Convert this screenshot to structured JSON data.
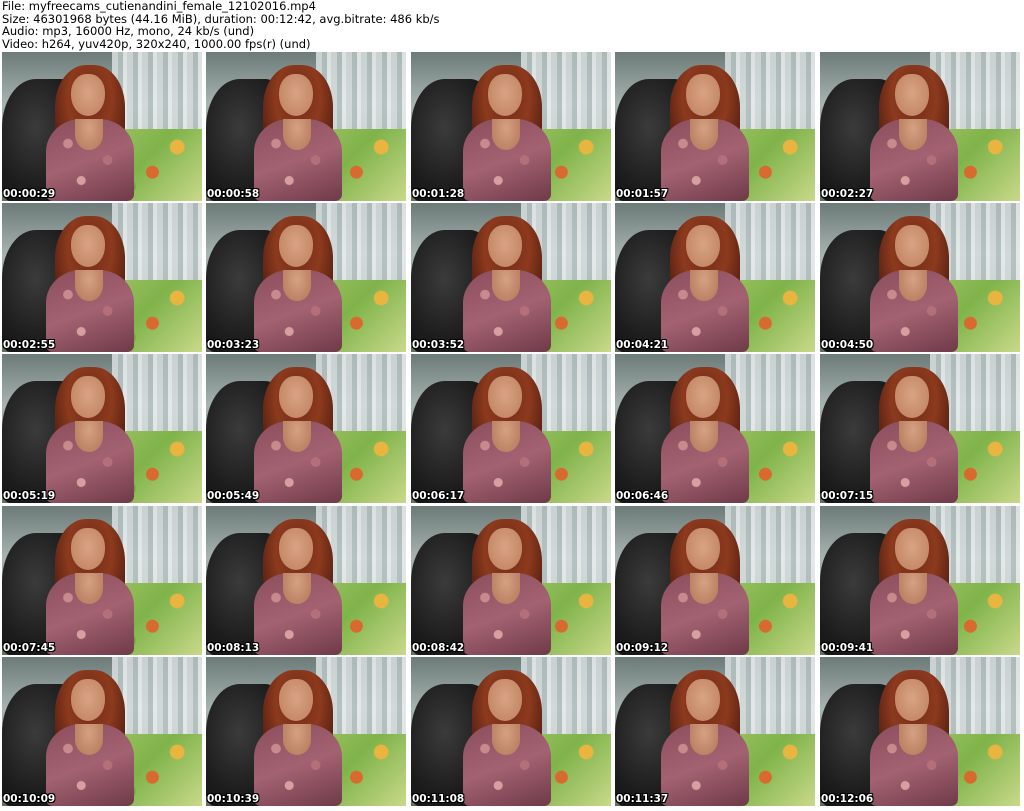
{
  "header": {
    "file": "File: myfreecams_cutienandini_female_12102016.mp4",
    "size": "Size: 46301968 bytes (44.16 MiB), duration: 00:12:42, avg.bitrate: 486 kb/s",
    "audio": "Audio: mp3, 16000 Hz, mono, 24 kb/s (und)",
    "video": "Video: h264, yuv420p, 320x240, 1000.00 fps(r) (und)"
  },
  "thumbnails": [
    {
      "timestamp": "00:00:29"
    },
    {
      "timestamp": "00:00:58"
    },
    {
      "timestamp": "00:01:28"
    },
    {
      "timestamp": "00:01:57"
    },
    {
      "timestamp": "00:02:27"
    },
    {
      "timestamp": "00:02:55"
    },
    {
      "timestamp": "00:03:23"
    },
    {
      "timestamp": "00:03:52"
    },
    {
      "timestamp": "00:04:21"
    },
    {
      "timestamp": "00:04:50"
    },
    {
      "timestamp": "00:05:19"
    },
    {
      "timestamp": "00:05:49"
    },
    {
      "timestamp": "00:06:17"
    },
    {
      "timestamp": "00:06:46"
    },
    {
      "timestamp": "00:07:15"
    },
    {
      "timestamp": "00:07:45"
    },
    {
      "timestamp": "00:08:13"
    },
    {
      "timestamp": "00:08:42"
    },
    {
      "timestamp": "00:09:12"
    },
    {
      "timestamp": "00:09:41"
    },
    {
      "timestamp": "00:10:09"
    },
    {
      "timestamp": "00:10:39"
    },
    {
      "timestamp": "00:11:08"
    },
    {
      "timestamp": "00:11:37"
    },
    {
      "timestamp": "00:12:06"
    }
  ]
}
